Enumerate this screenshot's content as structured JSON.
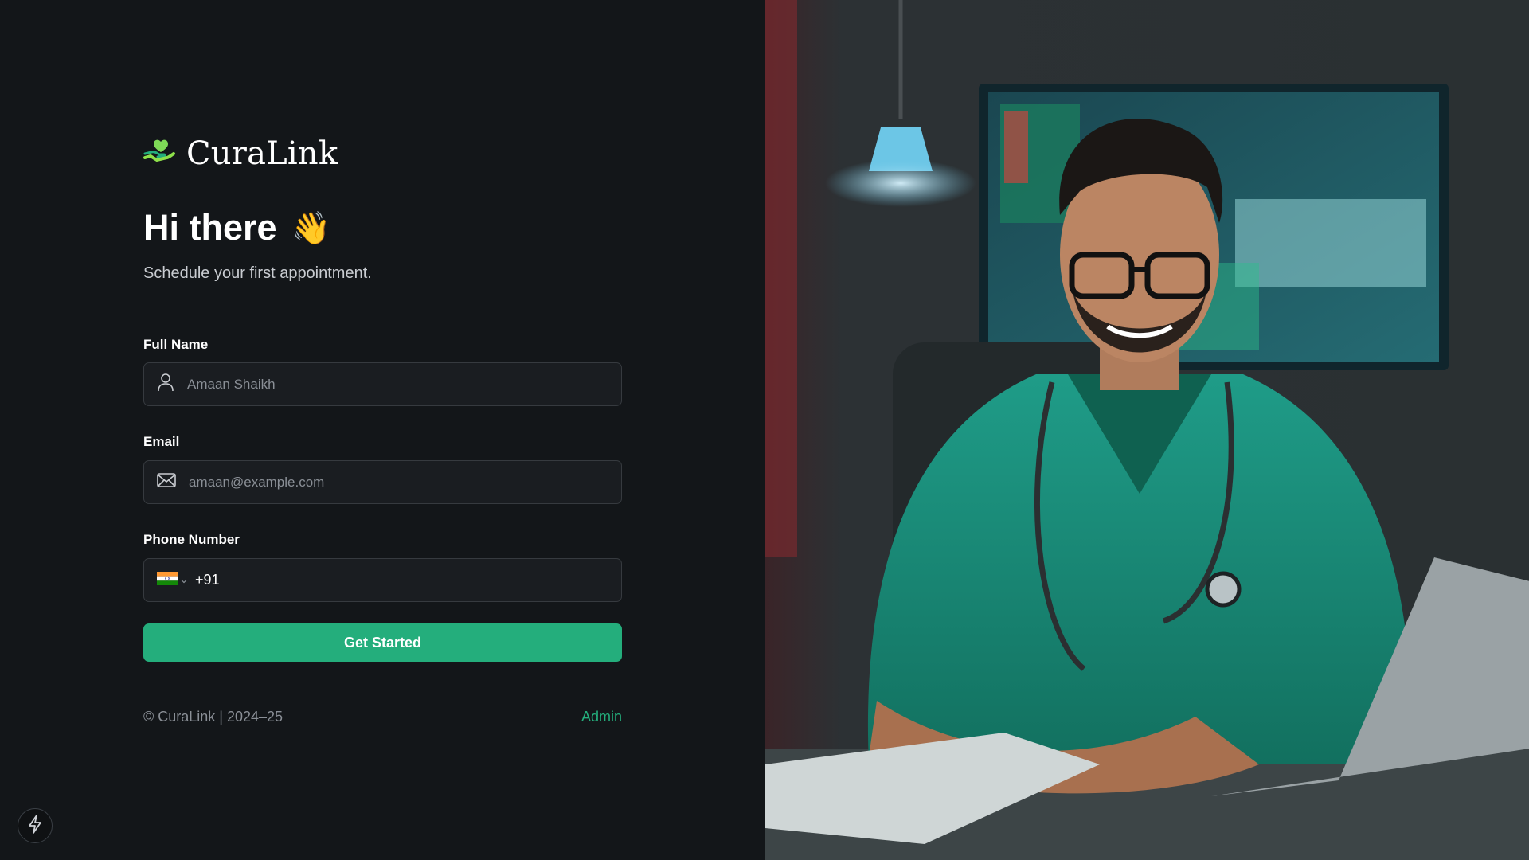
{
  "brand": {
    "name": "CuraLink",
    "accent": "#24ae7c"
  },
  "greeting": {
    "title": "Hi there",
    "emoji": "👋",
    "subtitle": "Schedule your first appointment."
  },
  "form": {
    "full_name": {
      "label": "Full Name",
      "placeholder": "Amaan Shaikh",
      "icon": "user-icon"
    },
    "email": {
      "label": "Email",
      "placeholder": "amaan@example.com",
      "icon": "mail-icon"
    },
    "phone": {
      "label": "Phone Number",
      "country": "IN",
      "country_code": "+91"
    },
    "submit_label": "Get Started"
  },
  "footer": {
    "copyright": "© CuraLink | 2024–25",
    "admin_link": "Admin"
  },
  "colors": {
    "background": "#131619",
    "input_bg": "#1a1d21",
    "input_border": "#363a3f",
    "button": "#24ae7c",
    "muted_text": "#8a8f96"
  }
}
